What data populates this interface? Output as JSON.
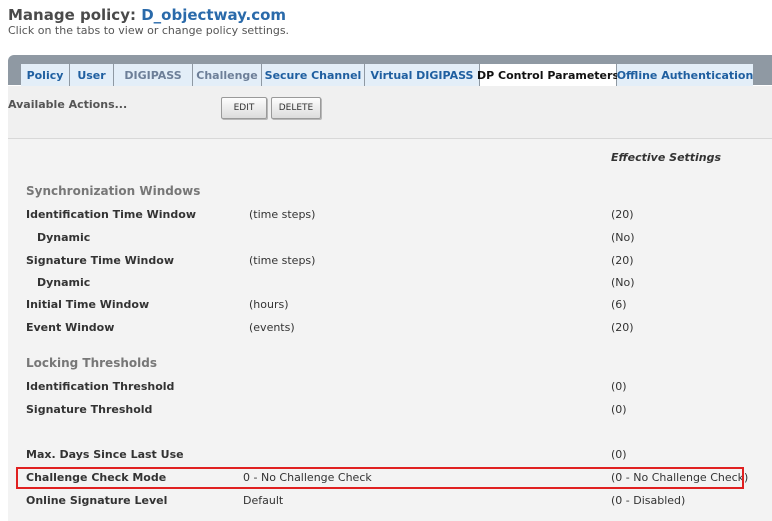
{
  "header": {
    "title_prefix": "Manage policy:",
    "policy_name": "D_objectway.com",
    "subtitle": "Click on the tabs to view or change policy settings."
  },
  "tabs": [
    {
      "label": "Policy",
      "active": false
    },
    {
      "label": "User",
      "active": false
    },
    {
      "label": "DIGIPASS",
      "active": false
    },
    {
      "label": "Challenge",
      "active": false
    },
    {
      "label": "Secure Channel",
      "active": false
    },
    {
      "label": "Virtual DIGIPASS",
      "active": false
    },
    {
      "label": "DP Control Parameters",
      "active": true
    },
    {
      "label": "Offline Authentication",
      "active": false
    }
  ],
  "actions": {
    "label": "Available Actions...",
    "edit_label": "EDIT",
    "delete_label": "DELETE"
  },
  "settings": {
    "effective_header": "Effective Settings",
    "sync_section": "Synchronization Windows",
    "lock_section": "Locking Thresholds",
    "rows": [
      {
        "label": "Identification Time Window",
        "unit": "(time steps)",
        "effective": "(20)"
      },
      {
        "label": "Dynamic",
        "effective": "(No)"
      },
      {
        "label": "Signature Time Window",
        "unit": "(time steps)",
        "effective": "(20)"
      },
      {
        "label": "Dynamic",
        "effective": "(No)"
      },
      {
        "label": "Initial Time Window",
        "unit": "(hours)",
        "effective": "(6)"
      },
      {
        "label": "Event Window",
        "unit": "(events)",
        "effective": "(20)"
      },
      {
        "label": "Identification Threshold",
        "effective": "(0)"
      },
      {
        "label": "Signature Threshold",
        "effective": "(0)"
      },
      {
        "label": "Max. Days Since Last Use",
        "effective": "(0)"
      },
      {
        "label": "Challenge Check Mode",
        "value": "0 - No Challenge Check",
        "effective": "(0 - No Challenge Check)"
      },
      {
        "label": "Online Signature Level",
        "value": "Default",
        "effective": "(0 - Disabled)"
      }
    ]
  },
  "colors": {
    "highlight": "#e02020",
    "tab_text": "#1f5fa0",
    "policy_name": "#2a6aaa"
  }
}
